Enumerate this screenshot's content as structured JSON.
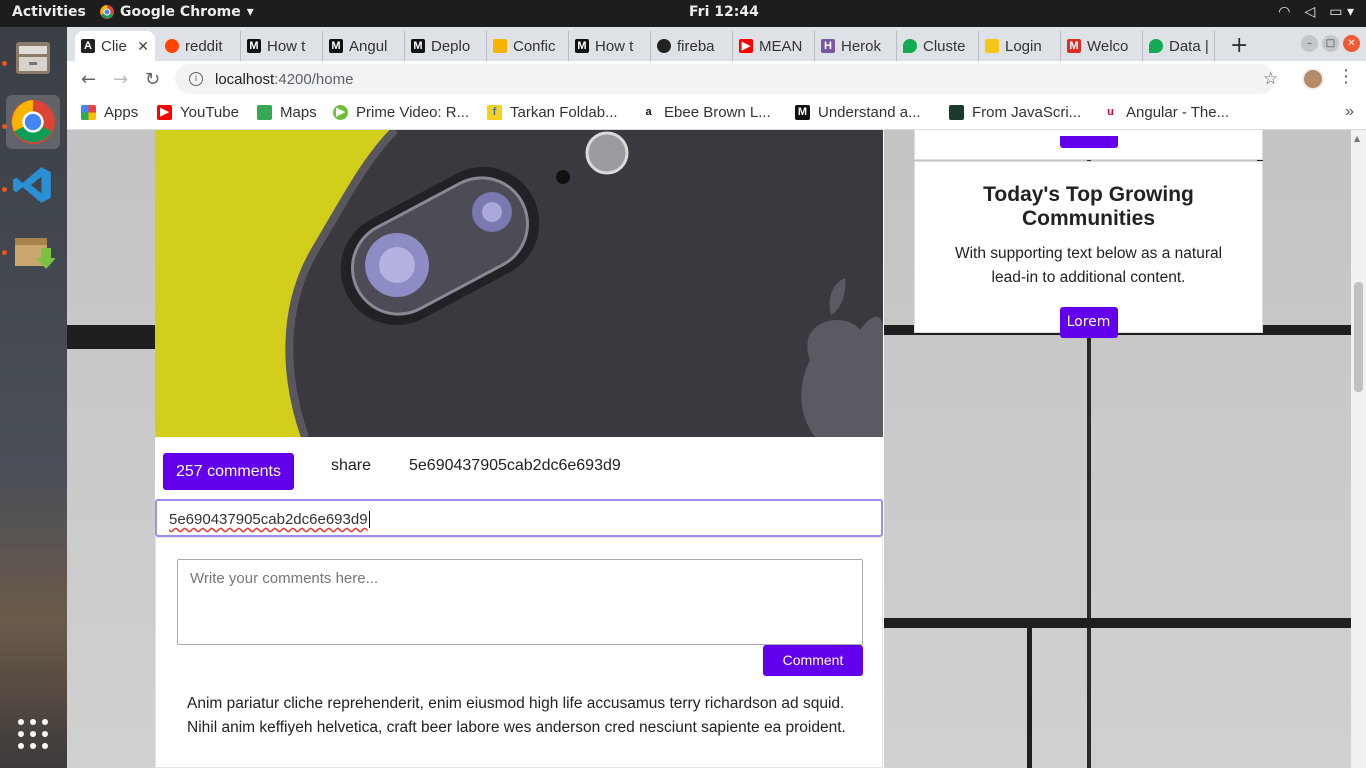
{
  "system": {
    "activities": "Activities",
    "app_name": "Google Chrome",
    "clock": "Fri 12:44"
  },
  "tabs": [
    {
      "label": "Clie",
      "active": true
    },
    {
      "label": "reddit"
    },
    {
      "label": "How t"
    },
    {
      "label": "Angul"
    },
    {
      "label": "Deplo"
    },
    {
      "label": "Confic"
    },
    {
      "label": "How t"
    },
    {
      "label": "fireba"
    },
    {
      "label": "MEAN"
    },
    {
      "label": "Herok"
    },
    {
      "label": "Cluste"
    },
    {
      "label": "Login"
    },
    {
      "label": "Welco"
    },
    {
      "label": "Data |"
    }
  ],
  "address": {
    "host": "localhost",
    "path": ":4200/home"
  },
  "bookmarks": [
    {
      "label": "Apps"
    },
    {
      "label": "YouTube"
    },
    {
      "label": "Maps"
    },
    {
      "label": "Prime Video: R..."
    },
    {
      "label": "Tarkan Foldab..."
    },
    {
      "label": "Ebee Brown L..."
    },
    {
      "label": "Understand a..."
    },
    {
      "label": "From JavaScri..."
    },
    {
      "label": "Angular - The..."
    }
  ],
  "post": {
    "comments_button": "257 comments",
    "share": "share",
    "post_id": "5e690437905cab2dc6e693d9",
    "id_input_value": "5e690437905cab2dc6e693d9",
    "comment_placeholder": "Write your comments here...",
    "comment_button": "Comment",
    "body": "Anim pariatur cliche reprehenderit, enim eiusmod high life accusamus terry richardson ad squid. Nihil anim keffiyeh helvetica, craft beer labore wes anderson cred nesciunt sapiente ea proident."
  },
  "sidebar": {
    "title": "Today's Top Growing Communities",
    "text": "With supporting text below as a natural lead-in to additional content.",
    "button": "Lorem"
  },
  "colors": {
    "accent": "#6200ee"
  }
}
